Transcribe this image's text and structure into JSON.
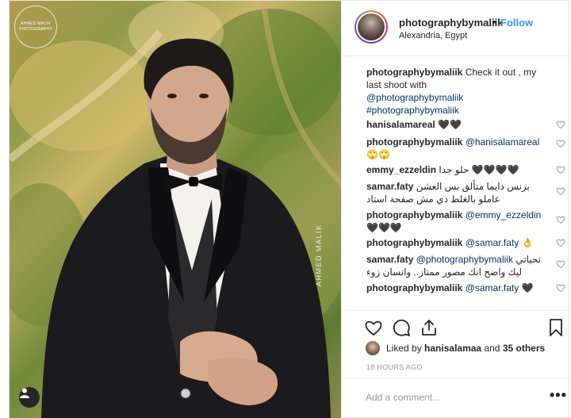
{
  "photo": {
    "watermark_logo": "AHMED MALIK PHOTOGRAPHY",
    "watermark_side": "AHMED MALIK",
    "user_tag_icon": "user-tag-icon"
  },
  "header": {
    "username": "photographybymaliik",
    "separator": "•",
    "follow_label": "Follow",
    "location": "Alexandria, Egypt"
  },
  "caption": {
    "username": "photographybymaliik",
    "text": "Check it out , my last shoot with",
    "mention": "@photographybymaliik",
    "hashtag": "#photographybymaliik"
  },
  "comments": [
    {
      "username": "hanisalamareal",
      "text": "🖤🖤",
      "mention": ""
    },
    {
      "username": "photographybymaliik",
      "mention": "@hanisalamareal",
      "text": "🙄🙄"
    },
    {
      "username": "emmy_ezzeldin",
      "text": "حلو جدا 🖤🖤🖤🖤",
      "mention": ""
    },
    {
      "username": "samar.faty",
      "text": "برنس دايما متألق بس العشن عاملو بالغلط دي مش صفحة استاد",
      "mention": ""
    },
    {
      "username": "photographybymaliik",
      "mention": "@emmy_ezzeldin",
      "text": "🖤🖤🖤"
    },
    {
      "username": "photographybymaliik",
      "mention": "@samar.faty",
      "text": "👌"
    },
    {
      "username": "samar.faty",
      "mention": "@photographybymaliik",
      "text": "تحياتي ليك واضح انك مصور ممتاز.. وانسان زوء"
    },
    {
      "username": "photographybymaliik",
      "mention": "@samar.faty",
      "text": "🖤"
    }
  ],
  "actions": {
    "like_icon": "heart-icon",
    "comment_icon": "comment-icon",
    "share_icon": "share-icon",
    "save_icon": "bookmark-icon"
  },
  "likes": {
    "prefix": "Liked by",
    "user": "hanisalamaa",
    "middle": "and",
    "others": "35 others"
  },
  "timestamp": "18 HOURS AGO",
  "add_comment": {
    "placeholder": "Add a comment...",
    "more_label": "•••"
  },
  "colors": {
    "link_blue": "#3897f0",
    "mention_blue": "#003569",
    "text": "#262626",
    "muted": "#999999",
    "border": "#efefef"
  }
}
